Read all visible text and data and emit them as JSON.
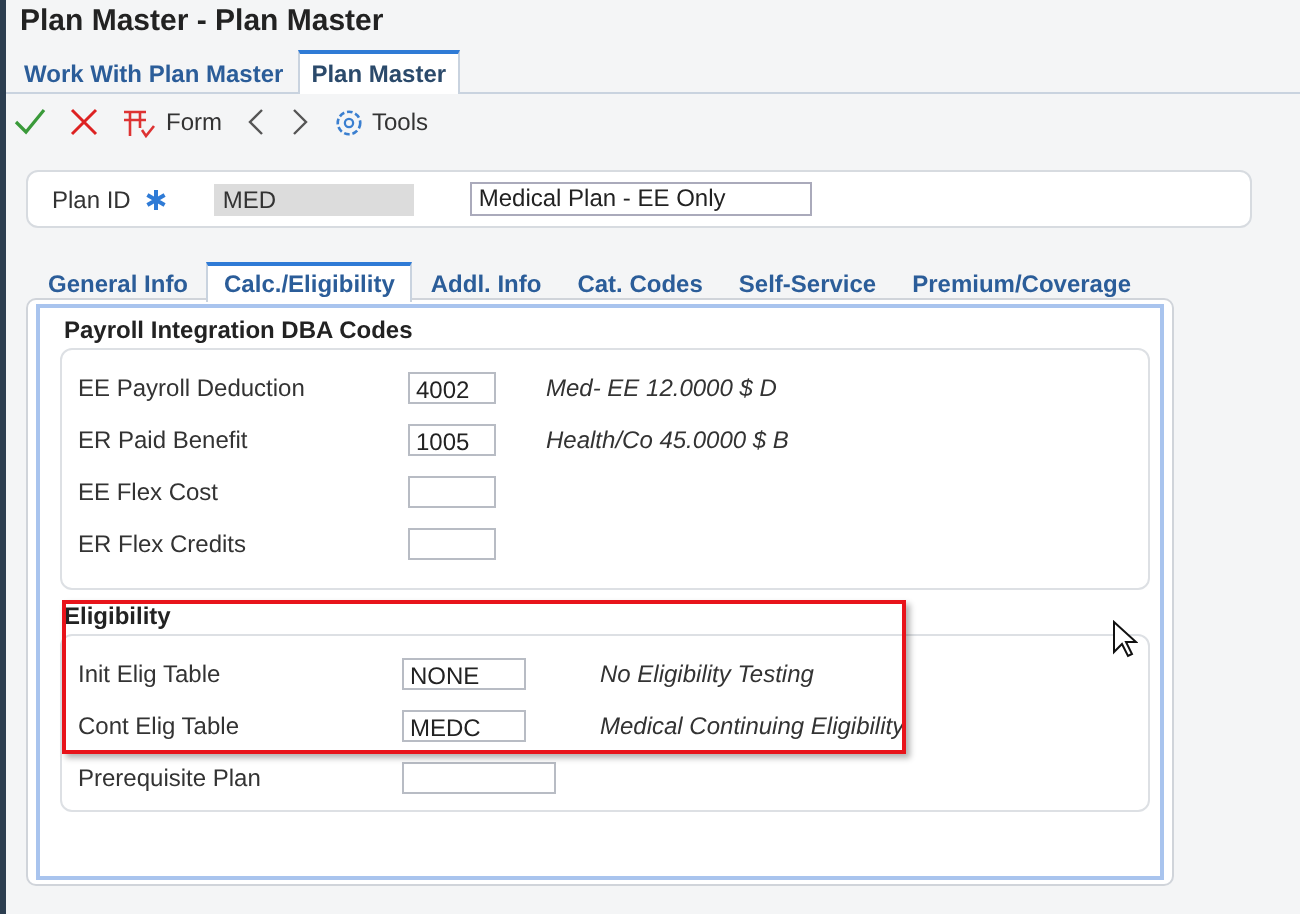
{
  "window": {
    "title": "Plan Master - Plan Master"
  },
  "app_tabs": [
    {
      "label": "Work With Plan Master",
      "selected": false
    },
    {
      "label": "Plan Master",
      "selected": true
    }
  ],
  "toolbar": {
    "form": "Form",
    "tools": "Tools"
  },
  "header": {
    "label": "Plan ID",
    "plan_id": "MED",
    "description": "Medical Plan - EE Only"
  },
  "form_tabs": [
    {
      "label": "General Info",
      "selected": false
    },
    {
      "label": "Calc./Eligibility",
      "selected": true
    },
    {
      "label": "Addl. Info",
      "selected": false
    },
    {
      "label": "Cat. Codes",
      "selected": false
    },
    {
      "label": "Self-Service",
      "selected": false
    },
    {
      "label": "Premium/Coverage",
      "selected": false
    }
  ],
  "payroll": {
    "title": "Payroll Integration DBA Codes",
    "rows": [
      {
        "label": "EE Payroll Deduction",
        "value": "4002",
        "description": "Med- EE 12.0000 $ D"
      },
      {
        "label": "ER Paid Benefit",
        "value": "1005",
        "description": "Health/Co 45.0000 $ B"
      },
      {
        "label": "EE Flex Cost"
      },
      {
        "label": "ER Flex Credits"
      }
    ]
  },
  "eligibility": {
    "title": "Eligibility",
    "rows": [
      {
        "label": "Init Elig Table",
        "value": "NONE",
        "description": "No Eligibility Testing"
      },
      {
        "label": "Cont Elig Table",
        "value": "MEDC",
        "description": "Medical Continuing Eligibility"
      },
      {
        "label": "Prerequisite Plan"
      }
    ]
  }
}
